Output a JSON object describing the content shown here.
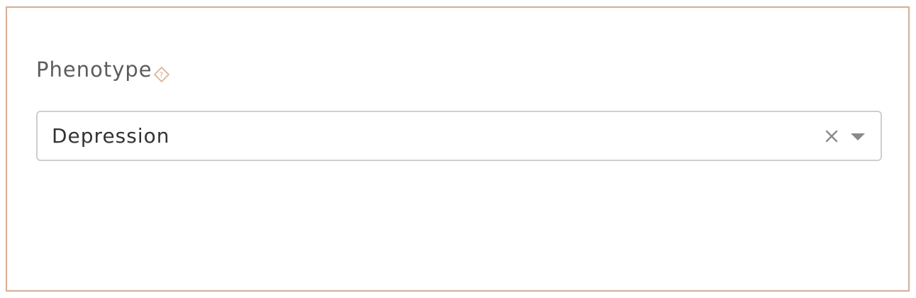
{
  "phenotype_field": {
    "label": "Phenotype",
    "help_icon": "question-diamond-icon",
    "selected_value": "Depression",
    "clear_icon": "close-icon",
    "dropdown_icon": "caret-down-icon"
  },
  "colors": {
    "panel_border": "#e9a98b",
    "accent": "#e9a98b",
    "label_text": "#5c5c5c",
    "value_text": "#333333",
    "input_border": "#cfcfcf",
    "icon_gray": "#8a8a8a"
  }
}
